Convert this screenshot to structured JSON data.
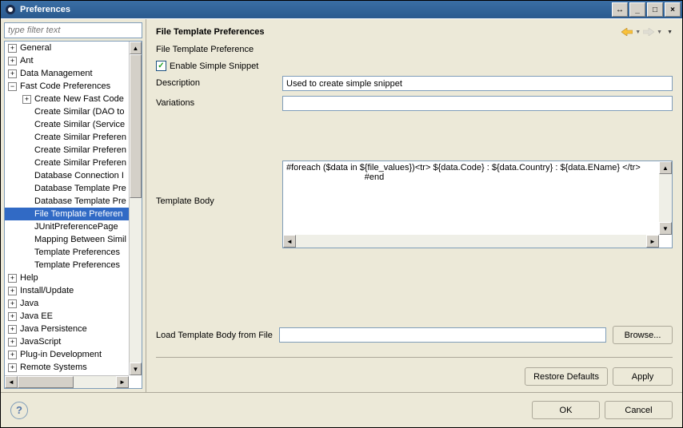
{
  "window": {
    "title": "Preferences"
  },
  "sidebar": {
    "filter_placeholder": "type filter text",
    "items": [
      {
        "label": "General",
        "depth": 0,
        "expanded": false,
        "children": true
      },
      {
        "label": "Ant",
        "depth": 0,
        "expanded": false,
        "children": true
      },
      {
        "label": "Data Management",
        "depth": 0,
        "expanded": false,
        "children": true
      },
      {
        "label": "Fast Code Preferences",
        "depth": 0,
        "expanded": true,
        "children": true
      },
      {
        "label": "Create New Fast Code",
        "depth": 1,
        "expanded": false,
        "children": true
      },
      {
        "label": "Create Similar (DAO to",
        "depth": 1,
        "children": false
      },
      {
        "label": "Create Similar (Service",
        "depth": 1,
        "children": false
      },
      {
        "label": "Create Similar Preferen",
        "depth": 1,
        "children": false
      },
      {
        "label": "Create Similar Preferen",
        "depth": 1,
        "children": false
      },
      {
        "label": "Create Similar Preferen",
        "depth": 1,
        "children": false
      },
      {
        "label": "Database Connection I",
        "depth": 1,
        "children": false
      },
      {
        "label": "Database Template Pre",
        "depth": 1,
        "children": false
      },
      {
        "label": "Database Template Pre",
        "depth": 1,
        "children": false
      },
      {
        "label": "File Template Preferen",
        "depth": 1,
        "children": false,
        "selected": true
      },
      {
        "label": "JUnitPreferencePage",
        "depth": 1,
        "children": false
      },
      {
        "label": "Mapping Between Simil",
        "depth": 1,
        "children": false
      },
      {
        "label": "Template Preferences",
        "depth": 1,
        "children": false
      },
      {
        "label": "Template Preferences",
        "depth": 1,
        "children": false
      },
      {
        "label": "Help",
        "depth": 0,
        "expanded": false,
        "children": true
      },
      {
        "label": "Install/Update",
        "depth": 0,
        "expanded": false,
        "children": true
      },
      {
        "label": "Java",
        "depth": 0,
        "expanded": false,
        "children": true
      },
      {
        "label": "Java EE",
        "depth": 0,
        "expanded": false,
        "children": true
      },
      {
        "label": "Java Persistence",
        "depth": 0,
        "expanded": false,
        "children": true
      },
      {
        "label": "JavaScript",
        "depth": 0,
        "expanded": false,
        "children": true
      },
      {
        "label": "Plug-in Development",
        "depth": 0,
        "expanded": false,
        "children": true
      },
      {
        "label": "Remote Systems",
        "depth": 0,
        "expanded": false,
        "children": true
      }
    ]
  },
  "page": {
    "title": "File Template Preferences",
    "section_label": "File Template Preference",
    "enable_label": "Enable Simple Snippet",
    "enable_checked": true,
    "description_label": "Description",
    "description_value": "Used to create simple snippet",
    "variations_label": "Variations",
    "variations_value": "",
    "template_body_label": "Template Body",
    "template_body_value": "#foreach ($data in ${file_values})<tr> ${data.Code} : ${data.Country} : ${data.EName} </tr>\n                                #end",
    "load_file_label": "Load Template Body from File",
    "load_file_value": "",
    "browse_label": "Browse...",
    "restore_defaults_label": "Restore Defaults",
    "apply_label": "Apply",
    "ok_label": "OK",
    "cancel_label": "Cancel"
  }
}
